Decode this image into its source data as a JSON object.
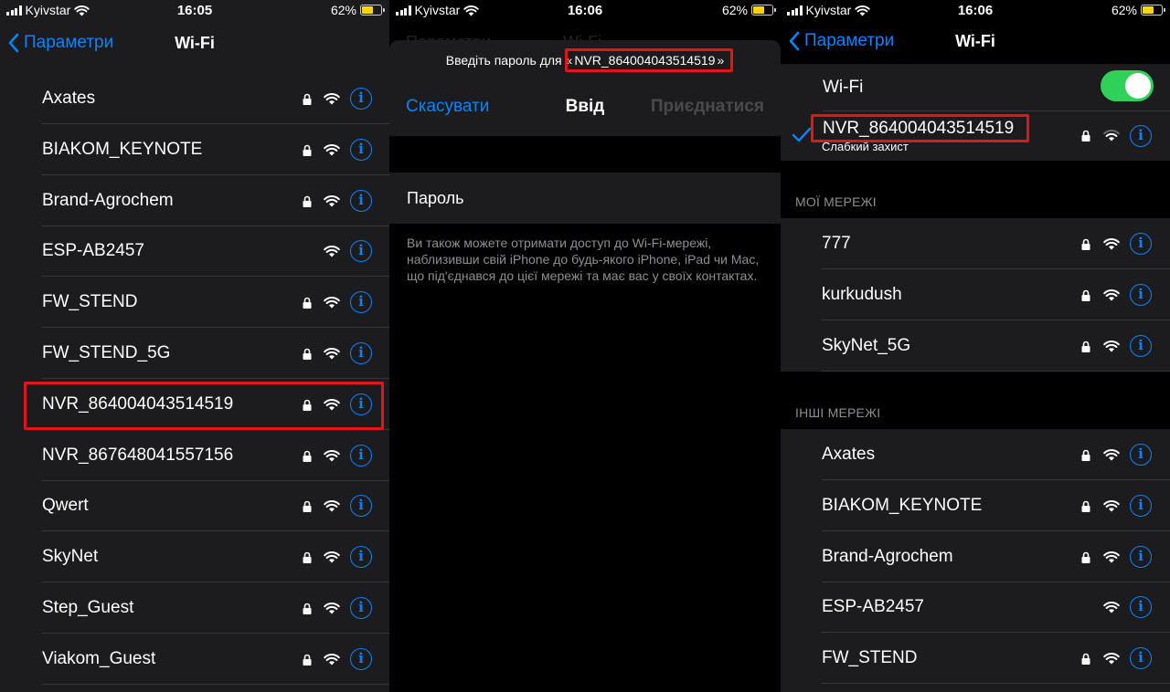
{
  "status": {
    "left": {
      "carrier": "Kyivstar",
      "time": "16:05",
      "battery": "62%"
    },
    "middle": {
      "carrier": "Kyivstar",
      "time": "16:06",
      "battery": "62%"
    },
    "right": {
      "carrier": "Kyivstar",
      "time": "16:06",
      "battery": "62%"
    },
    "battery_level": 0.62,
    "battery_color": "#ffd60a"
  },
  "nav": {
    "back_label": "Параметри",
    "title": "Wi-Fi"
  },
  "left_networks": [
    {
      "name": "Axates",
      "locked": true
    },
    {
      "name": "BIAKOM_KEYNOTE",
      "locked": true
    },
    {
      "name": "Brand-Agrochem",
      "locked": true
    },
    {
      "name": "ESP-AB2457",
      "locked": false
    },
    {
      "name": "FW_STEND",
      "locked": true
    },
    {
      "name": "FW_STEND_5G",
      "locked": true
    },
    {
      "name": "NVR_864004043514519",
      "locked": true,
      "highlighted": true
    },
    {
      "name": "NVR_867648041557156",
      "locked": true
    },
    {
      "name": "Qwert",
      "locked": true
    },
    {
      "name": "SkyNet",
      "locked": true
    },
    {
      "name": "Step_Guest",
      "locked": true
    },
    {
      "name": "Viakom_Guest",
      "locked": true
    }
  ],
  "password_sheet": {
    "prompt_prefix": "Введіть пароль для «",
    "network": "NVR_864004043514519",
    "prompt_suffix": "»",
    "cancel_label": "Скасувати",
    "title": "Ввід",
    "join_label": "Приєднатися",
    "password_label": "Пароль",
    "note": "Ви також можете отримати доступ до Wi-Fi-мережі, наблизивши свій iPhone до будь-якого iPhone, iPad чи Mac, що під'єднався до цієї мережі та має вас у своїх контактах.",
    "dim_back": "Параметри",
    "dim_title": "Wi-Fi"
  },
  "wifi_settings": {
    "wifi_label": "Wi-Fi",
    "wifi_on": true,
    "toggle_color": "#30d158",
    "connected": {
      "name": "NVR_864004043514519",
      "subtitle": "Слабкий захист"
    },
    "my_networks_header": "МОЇ МЕРЕЖІ",
    "my_networks": [
      "777",
      "kurkudush",
      "SkyNet_5G"
    ],
    "other_networks_header": "ІНШІ МЕРЕЖІ",
    "other_networks": [
      {
        "name": "Axates",
        "locked": true
      },
      {
        "name": "BIAKOM_KEYNOTE",
        "locked": true
      },
      {
        "name": "Brand-Agrochem",
        "locked": true
      },
      {
        "name": "ESP-AB2457",
        "locked": false
      },
      {
        "name": "FW_STEND",
        "locked": true
      }
    ]
  },
  "icons": {
    "lock": "lock-icon",
    "wifi": "wifi-icon",
    "info": "info-icon",
    "check": "checkmark-icon",
    "back": "chevron-left-icon"
  },
  "colors": {
    "accent": "#0a84ff",
    "highlight": "#e0161b"
  }
}
